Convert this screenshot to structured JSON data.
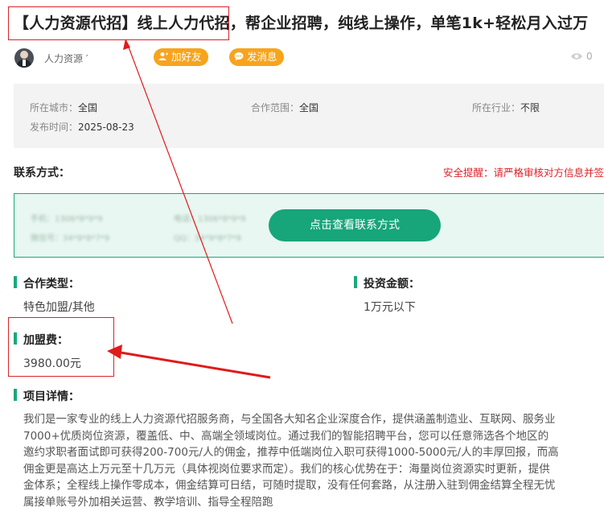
{
  "title": "【人力资源代招】线上人力代招，帮企业招聘，纯线上操作，单笔1k+轻松月入过万",
  "author": {
    "name": "人力资源  ′",
    "add_friend_label": "加好友",
    "send_message_label": "发消息",
    "view_count": "0"
  },
  "info": {
    "city_label": "所在城市：",
    "city_value": "全国",
    "scope_label": "合作范围：",
    "scope_value": "全国",
    "industry_label": "所在行业：",
    "industry_value": "不限",
    "publish_label": "发布时间：",
    "publish_value": "2025-08-23"
  },
  "contact": {
    "title": "联系方式：",
    "safety_tip": "安全提醒：请严格审核对方信息并签",
    "view_button": "点击查看联系方式",
    "blurred": {
      "phone_label": "手机：",
      "phone_value": "1306*8*9*9",
      "tel_label": "电话：",
      "tel_value": "1306*8*9*9",
      "wechat_label": "微信号：",
      "wechat_value": "34*9*8*7*9",
      "qq_label": "QQ：",
      "qq_value": "34*9*8*7*9"
    }
  },
  "cooperation_type": {
    "label": "合作类型：",
    "value": "特色加盟/其他"
  },
  "investment": {
    "label": "投资金额：",
    "value": "1万元以下"
  },
  "franchise_fee": {
    "label": "加盟费：",
    "value": "3980.00元"
  },
  "detail": {
    "label": "项目详情：",
    "lines": [
      "我们是一家专业的线上人力资源代招服务商，与全国各大知名企业深度合作，提供涵盖制造业、互联网、服务业",
      "7000+优质岗位资源，覆盖低、中、高端全领域岗位。通过我们的智能招聘平台，您可以任意筛选各个地区的",
      "邀约求职者面试即可获得200-700元/人的佣金，推荐中低端岗位入职可获得1000-5000元/人的丰厚回报，而高",
      "佣金更是高达上万元至十几万元（具体视岗位要求而定）。我们的核心优势在于：海量岗位资源实时更新，提供",
      "金体系；全程线上操作零成本，佣金结算可日结，可随时提取，没有任何套路，从注册入驻到佣金结算全程无忧",
      "属接单账号外加相关运营、教学培训、指导全程陪跑"
    ]
  },
  "colors": {
    "accent_green": "#1aa97b",
    "button_orange": "#f7a41d",
    "warning_red": "#d9242a",
    "annotation_red": "#e01b1b"
  },
  "icons": {
    "add_friend": "add-user-icon",
    "send_message": "chat-bubble-icon",
    "views": "eye-icon"
  }
}
